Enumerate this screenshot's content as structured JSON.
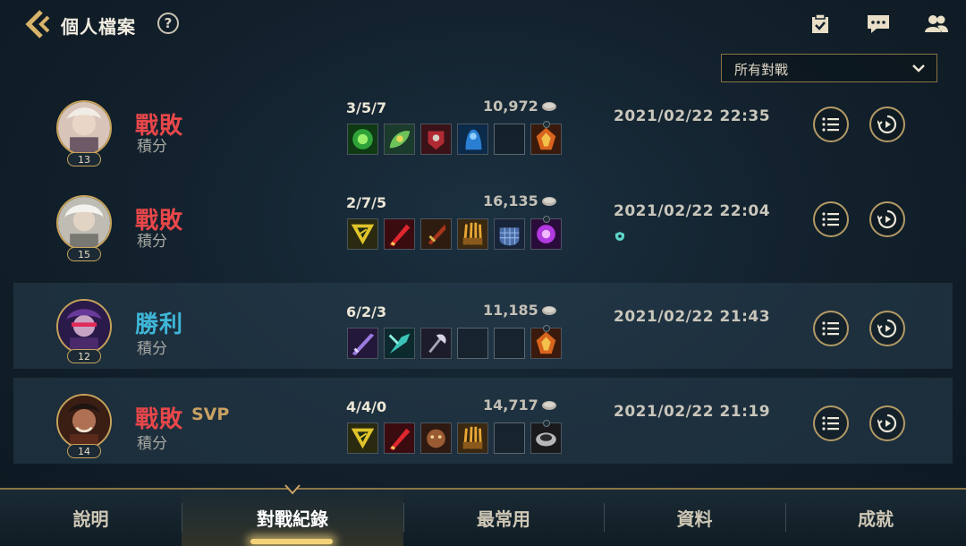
{
  "header": {
    "back_icon": "chevron-left-icon",
    "title": "個人檔案",
    "help_label": "?",
    "icons": [
      "checklist-icon",
      "chat-icon",
      "friends-icon"
    ]
  },
  "filter": {
    "selected": "所有對戰"
  },
  "matches": [
    {
      "hero_level": "13",
      "result": "戰敗",
      "result_type": "lose",
      "mode": "積分",
      "kda": "3/5/7",
      "gold": "10,972",
      "datetime": "2021/02/22 22:35",
      "items": [
        "green-rune-item-icon",
        "green-leaf-item-icon",
        "red-armor-item-icon",
        "blue-cloak-item-icon",
        "empty-slot",
        "flame-emblem-item-icon"
      ]
    },
    {
      "hero_level": "15",
      "result": "戰敗",
      "result_type": "lose",
      "mode": "積分",
      "kda": "2/7/5",
      "gold": "16,135",
      "datetime": "2021/02/22 22:04",
      "items": [
        "triangle-rune-item-icon",
        "red-blade-item-icon",
        "crimson-dagger-item-icon",
        "claw-gauntlet-item-icon",
        "scale-mail-item-icon",
        "purple-orb-item-icon"
      ]
    },
    {
      "hero_level": "12",
      "result": "勝利",
      "result_type": "win",
      "mode": "積分",
      "kda": "6/2/3",
      "gold": "11,185",
      "datetime": "2021/02/22 21:43",
      "items": [
        "purple-sword-item-icon",
        "teal-blade-item-icon",
        "silver-axe-item-icon",
        "empty-slot",
        "empty-slot",
        "flame-emblem-item-icon"
      ]
    },
    {
      "hero_level": "14",
      "result": "戰敗",
      "result_type": "lose",
      "mode": "積分",
      "svp": "SVP",
      "kda": "4/4/0",
      "gold": "14,717",
      "datetime": "2021/02/22 21:19",
      "items": [
        "triangle-rune-item-icon",
        "red-blade-item-icon",
        "beast-mask-item-icon",
        "claw-gauntlet-item-icon",
        "empty-slot",
        "iron-ring-item-icon"
      ]
    }
  ],
  "nav": {
    "tabs": [
      "說明",
      "對戰紀錄",
      "最常用",
      "資料",
      "成就"
    ],
    "active_index": 1
  },
  "colors": {
    "lose": "#e8474a",
    "win": "#3fb6d8",
    "gold_border": "#c7a25a",
    "background": "#13222e"
  }
}
